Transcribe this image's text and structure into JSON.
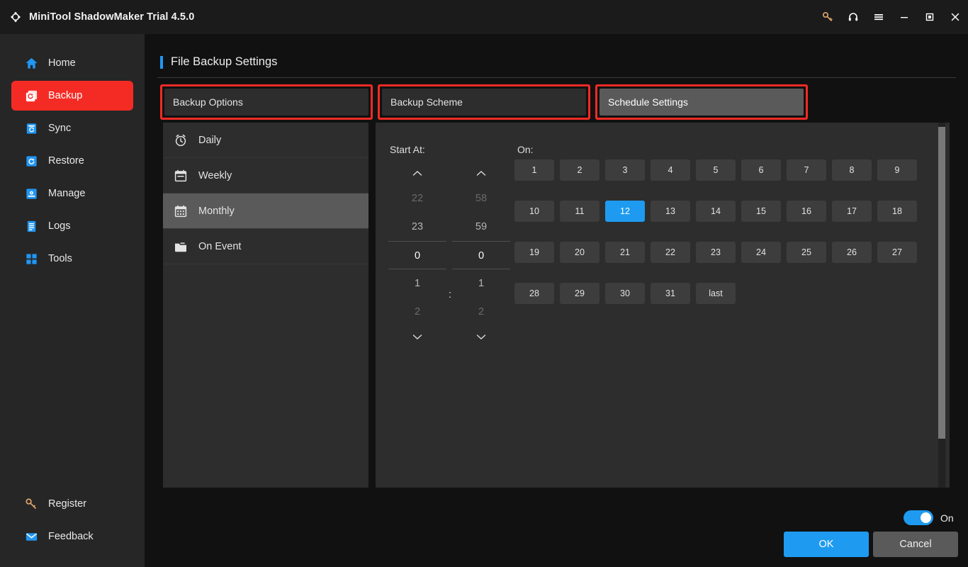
{
  "window": {
    "title": "MiniTool ShadowMaker Trial 4.5.0",
    "logo_icon": "refresh-arrows-logo-icon",
    "controls": [
      {
        "name": "key-icon",
        "label": "Register"
      },
      {
        "name": "headset-icon",
        "label": "Support"
      },
      {
        "name": "hamburger-menu-icon",
        "label": "Menu"
      },
      {
        "name": "minimize-icon",
        "label": "Minimize"
      },
      {
        "name": "maximize-icon",
        "label": "Maximize"
      },
      {
        "name": "close-icon",
        "label": "Close"
      }
    ]
  },
  "sidebar": {
    "items": [
      {
        "label": "Home",
        "icon": "home-icon",
        "active": false
      },
      {
        "label": "Backup",
        "icon": "backup-icon",
        "active": true
      },
      {
        "label": "Sync",
        "icon": "sync-icon",
        "active": false
      },
      {
        "label": "Restore",
        "icon": "restore-icon",
        "active": false
      },
      {
        "label": "Manage",
        "icon": "manage-icon",
        "active": false
      },
      {
        "label": "Logs",
        "icon": "logs-icon",
        "active": false
      },
      {
        "label": "Tools",
        "icon": "tools-icon",
        "active": false
      }
    ],
    "bottom_items": [
      {
        "label": "Register",
        "icon": "key-icon"
      },
      {
        "label": "Feedback",
        "icon": "envelope-icon"
      }
    ],
    "active_color": "#f42b25"
  },
  "header": {
    "title": "File Backup Settings",
    "accent_color": "#2196f3"
  },
  "tabs": [
    {
      "label": "Backup Options",
      "active": false,
      "annotated": true
    },
    {
      "label": "Backup Scheme",
      "active": false,
      "annotated": true
    },
    {
      "label": "Schedule Settings",
      "active": true,
      "annotated": true
    }
  ],
  "annotation_color": "#f42b25",
  "schedule_types": [
    {
      "label": "Daily",
      "icon": "alarm-clock-icon",
      "active": false
    },
    {
      "label": "Weekly",
      "icon": "calendar-icon",
      "active": false
    },
    {
      "label": "Monthly",
      "icon": "calendar-month-icon",
      "active": true
    },
    {
      "label": "On Event",
      "icon": "folder-icon",
      "active": false
    }
  ],
  "time_picker": {
    "start_at_label": "Start At:",
    "separator": ":",
    "hours": [
      "22",
      "23",
      "0",
      "1",
      "2"
    ],
    "minutes": [
      "58",
      "59",
      "0",
      "1",
      "2"
    ],
    "selected_index": 2,
    "selected_hour": "0",
    "selected_minute": "0",
    "up_arrow_icon": "chevron-up-icon",
    "down_arrow_icon": "chevron-down-icon"
  },
  "days": {
    "on_label": "On:",
    "values": [
      "1",
      "2",
      "3",
      "4",
      "5",
      "6",
      "7",
      "8",
      "9",
      "10",
      "11",
      "12",
      "13",
      "14",
      "15",
      "16",
      "17",
      "18",
      "19",
      "20",
      "21",
      "22",
      "23",
      "24",
      "25",
      "26",
      "27",
      "28",
      "29",
      "30",
      "31",
      "last"
    ],
    "selected": "12",
    "selected_color": "#1e9bf0"
  },
  "footer": {
    "toggle_label": "On",
    "toggle_on": true,
    "toggle_color": "#1e9bf0",
    "ok_label": "OK",
    "cancel_label": "Cancel"
  }
}
